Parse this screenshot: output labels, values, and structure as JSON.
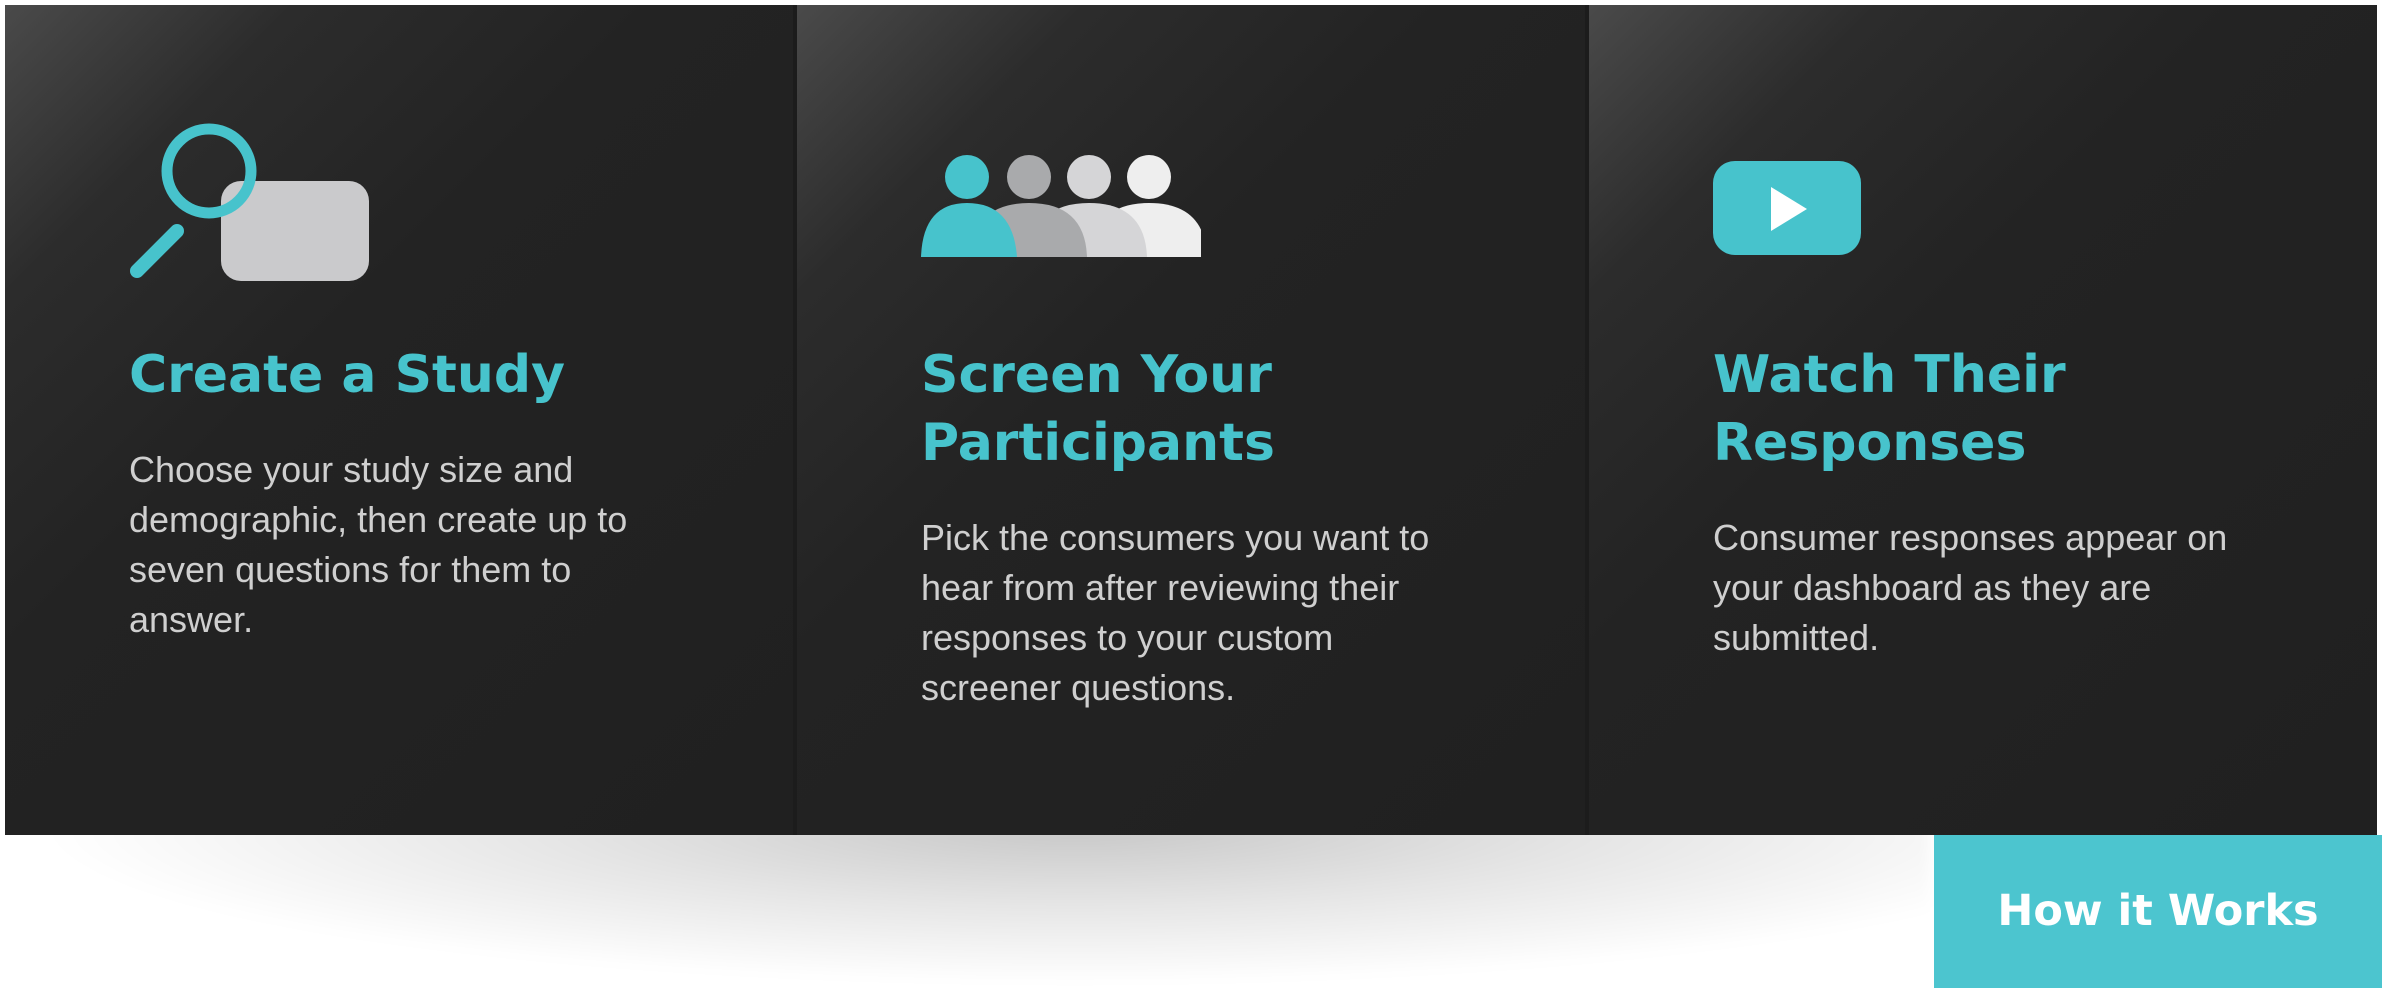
{
  "colors": {
    "accent": "#47c3cc",
    "panel_bg": "#222222",
    "text": "#cfcfcf"
  },
  "steps": [
    {
      "icon": "magnifier-document-icon",
      "title": "Create a Study",
      "description": "Choose your study size and demographic, then create up to seven questions for them to answer."
    },
    {
      "icon": "people-group-icon",
      "title": "Screen Your Participants",
      "description": "Pick the consumers you want to hear from after reviewing their responses to your custom screener questions."
    },
    {
      "icon": "video-play-icon",
      "title": "Watch Their Responses",
      "description": "Consumer responses appear on your dashboard as they are submitted."
    }
  ],
  "cta": {
    "label": "How it Works"
  }
}
